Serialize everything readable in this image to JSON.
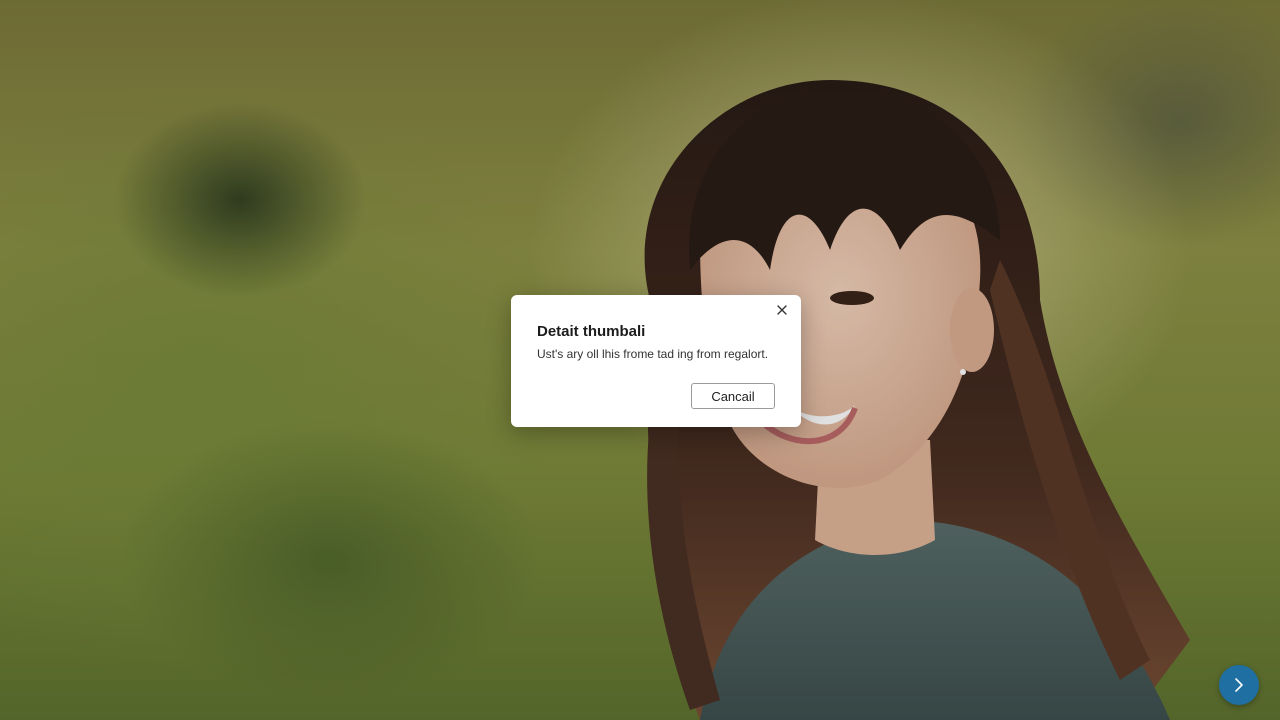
{
  "dialog": {
    "title": "Detait thumbali",
    "message": "Ust's ary oll lhis frome tad ing from regalort.",
    "cancel_label": "Cancail",
    "close_icon": "close-icon"
  },
  "navigation": {
    "next_icon": "chevron-right-icon"
  },
  "colors": {
    "accent": "#1f6fa3",
    "dialog_background": "#ffffff",
    "button_border": "#9a9a9a"
  }
}
